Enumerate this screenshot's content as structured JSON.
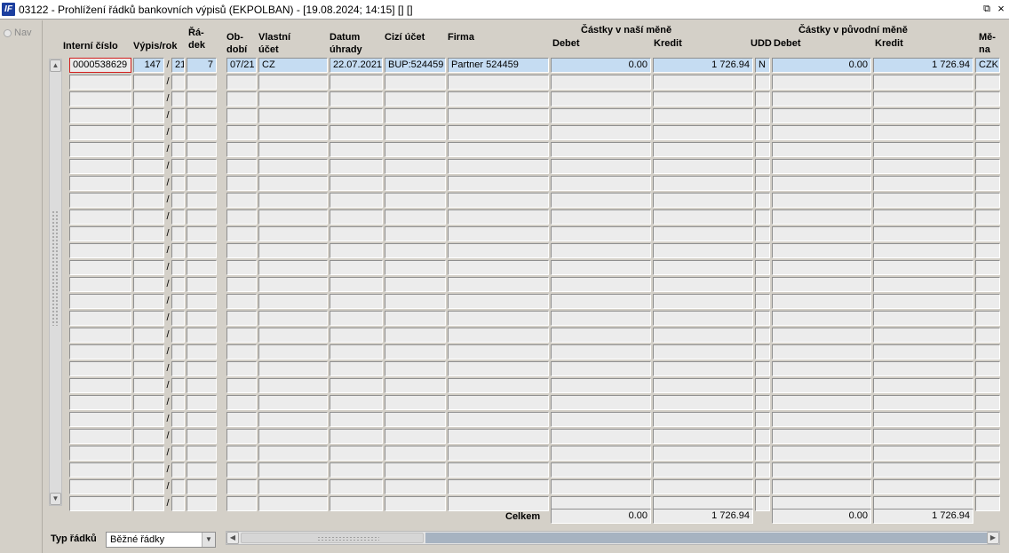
{
  "window": {
    "title": "03122 - Prohlížení řádků bankovních výpisů (EKPOLBAN) - [19.08.2024; 14:15] [] []",
    "icon_text": "IF",
    "restore_icon": "⧉",
    "close_icon": "×"
  },
  "nav": {
    "label": "Nav"
  },
  "headers": {
    "interni_cislo": "Interní číslo",
    "vypis_rok": "Výpis/rok",
    "radek_1": "Řá-",
    "radek_2": "dek",
    "obdobi_1": "Ob-",
    "obdobi_2": "dobí",
    "vlastni_1": "Vlastní",
    "vlastni_2": "účet",
    "datum_1": "Datum",
    "datum_2": "úhrady",
    "cizi_ucet": "Cizí účet",
    "firma": "Firma",
    "group_nase": "Částky v naší měně",
    "debet": "Debet",
    "kredit": "Kredit",
    "udd": "UDD",
    "group_puvodni": "Částky v původní měně",
    "debet2": "Debet",
    "kredit2": "Kredit",
    "mena_1": "Mě-",
    "mena_2": "na"
  },
  "rows": [
    {
      "interni_cislo": "0000538629",
      "vypis": "147",
      "rok": "21",
      "radek": "7",
      "obdobi": "07/21",
      "vlastni_ucet": "CZ",
      "datum_uhrady": "22.07.2021",
      "cizi_ucet": "BUP:524459",
      "firma": "Partner 524459",
      "debet": "0.00",
      "kredit": "1 726.94",
      "udd": "N",
      "debet_puv": "0.00",
      "kredit_puv": "1 726.94",
      "mena": "CZK"
    }
  ],
  "empty_rows": 26,
  "totals": {
    "label": "Celkem",
    "debet": "0.00",
    "kredit": "1 726.94",
    "debet_puv": "0.00",
    "kredit_puv": "1 726.94"
  },
  "footer": {
    "typ_label": "Typ řádků",
    "typ_value": "Běžné řádky"
  },
  "colors": {
    "selected_cell": "#c5dcf2",
    "focus_border": "#d21f1f",
    "background": "#d4d0c8"
  }
}
